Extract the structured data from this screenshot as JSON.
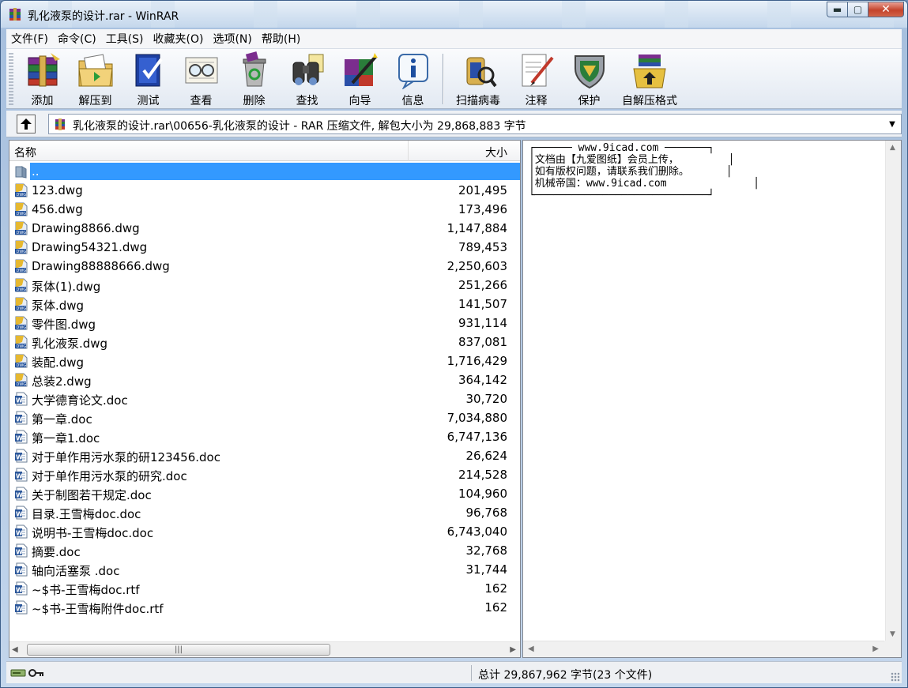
{
  "window": {
    "title": "乳化液泵的设计.rar - WinRAR",
    "min_label": "▬",
    "max_label": "▢",
    "close_label": "✕"
  },
  "menu": [
    "文件(F)",
    "命令(C)",
    "工具(S)",
    "收藏夹(O)",
    "选项(N)",
    "帮助(H)"
  ],
  "toolbar": {
    "add": "添加",
    "extract": "解压到",
    "test": "测试",
    "view": "查看",
    "delete": "删除",
    "find": "查找",
    "wizard": "向导",
    "info": "信息",
    "scan": "扫描病毒",
    "comment": "注释",
    "protect": "保护",
    "sfx": "自解压格式"
  },
  "address": {
    "path": "乳化液泵的设计.rar\\00656-乳化液泵的设计 - RAR 压缩文件, 解包大小为 29,868,883 字节"
  },
  "file_list": {
    "headers": {
      "name": "名称",
      "size": "大小"
    },
    "parent": "..",
    "files": [
      {
        "name": "123.dwg",
        "size": "201,495",
        "type": "dwg"
      },
      {
        "name": "456.dwg",
        "size": "173,496",
        "type": "dwg"
      },
      {
        "name": "Drawing8866.dwg",
        "size": "1,147,884",
        "type": "dwg"
      },
      {
        "name": "Drawing54321.dwg",
        "size": "789,453",
        "type": "dwg"
      },
      {
        "name": "Drawing88888666.dwg",
        "size": "2,250,603",
        "type": "dwg"
      },
      {
        "name": "泵体(1).dwg",
        "size": "251,266",
        "type": "dwg"
      },
      {
        "name": "泵体.dwg",
        "size": "141,507",
        "type": "dwg"
      },
      {
        "name": "零件图.dwg",
        "size": "931,114",
        "type": "dwg"
      },
      {
        "name": "乳化液泵.dwg",
        "size": "837,081",
        "type": "dwg"
      },
      {
        "name": "装配.dwg",
        "size": "1,716,429",
        "type": "dwg"
      },
      {
        "name": "总装2.dwg",
        "size": "364,142",
        "type": "dwg"
      },
      {
        "name": "大学德育论文.doc",
        "size": "30,720",
        "type": "doc"
      },
      {
        "name": "第一章.doc",
        "size": "7,034,880",
        "type": "doc"
      },
      {
        "name": "第一章1.doc",
        "size": "6,747,136",
        "type": "doc"
      },
      {
        "name": "对于单作用污水泵的研123456.doc",
        "size": "26,624",
        "type": "doc"
      },
      {
        "name": "对于单作用污水泵的研究.doc",
        "size": "214,528",
        "type": "doc"
      },
      {
        "name": "关于制图若干规定.doc",
        "size": "104,960",
        "type": "doc"
      },
      {
        "name": "目录.王雪梅doc.doc",
        "size": "96,768",
        "type": "doc"
      },
      {
        "name": "说明书-王雪梅doc.doc",
        "size": "6,743,040",
        "type": "doc"
      },
      {
        "name": "摘要.doc",
        "size": "32,768",
        "type": "doc"
      },
      {
        "name": "轴向活塞泵 .doc",
        "size": "31,744",
        "type": "doc"
      },
      {
        "name": "~$书-王雪梅doc.rtf",
        "size": "162",
        "type": "doc"
      },
      {
        "name": "~$书-王雪梅附件doc.rtf",
        "size": "162",
        "type": "doc"
      }
    ]
  },
  "comment": {
    "text": "┌────── www.9icad.com ───────┐\n│文档由【九爱图纸】会员上传，        │\n│如有版权问题，请联系我们删除。      │\n│机械帝国：www.9icad.com              │\n└────────────────────────────┘"
  },
  "status": {
    "summary": "总计 29,867,962 字节(23 个文件)"
  },
  "colors": {
    "selection": "#3399ff",
    "close_button": "#c4432b"
  }
}
